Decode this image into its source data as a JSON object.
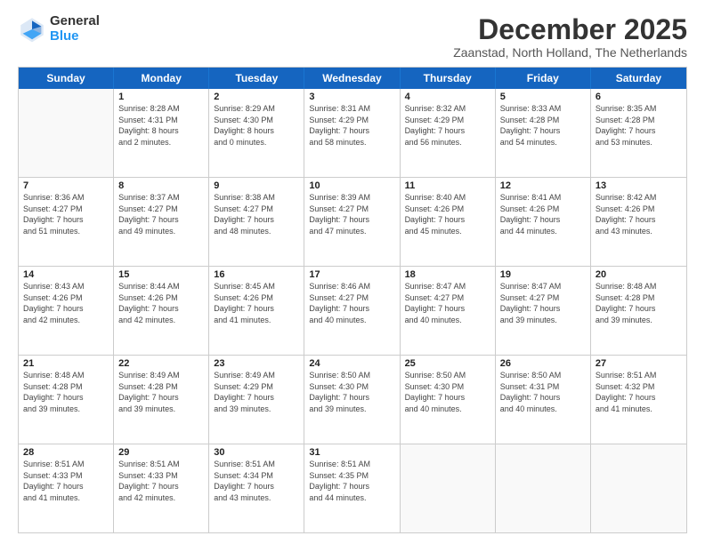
{
  "logo": {
    "general": "General",
    "blue": "Blue"
  },
  "title": "December 2025",
  "subtitle": "Zaanstad, North Holland, The Netherlands",
  "header_days": [
    "Sunday",
    "Monday",
    "Tuesday",
    "Wednesday",
    "Thursday",
    "Friday",
    "Saturday"
  ],
  "rows": [
    [
      {
        "day": "",
        "info": ""
      },
      {
        "day": "1",
        "info": "Sunrise: 8:28 AM\nSunset: 4:31 PM\nDaylight: 8 hours\nand 2 minutes."
      },
      {
        "day": "2",
        "info": "Sunrise: 8:29 AM\nSunset: 4:30 PM\nDaylight: 8 hours\nand 0 minutes."
      },
      {
        "day": "3",
        "info": "Sunrise: 8:31 AM\nSunset: 4:29 PM\nDaylight: 7 hours\nand 58 minutes."
      },
      {
        "day": "4",
        "info": "Sunrise: 8:32 AM\nSunset: 4:29 PM\nDaylight: 7 hours\nand 56 minutes."
      },
      {
        "day": "5",
        "info": "Sunrise: 8:33 AM\nSunset: 4:28 PM\nDaylight: 7 hours\nand 54 minutes."
      },
      {
        "day": "6",
        "info": "Sunrise: 8:35 AM\nSunset: 4:28 PM\nDaylight: 7 hours\nand 53 minutes."
      }
    ],
    [
      {
        "day": "7",
        "info": "Sunrise: 8:36 AM\nSunset: 4:27 PM\nDaylight: 7 hours\nand 51 minutes."
      },
      {
        "day": "8",
        "info": "Sunrise: 8:37 AM\nSunset: 4:27 PM\nDaylight: 7 hours\nand 49 minutes."
      },
      {
        "day": "9",
        "info": "Sunrise: 8:38 AM\nSunset: 4:27 PM\nDaylight: 7 hours\nand 48 minutes."
      },
      {
        "day": "10",
        "info": "Sunrise: 8:39 AM\nSunset: 4:27 PM\nDaylight: 7 hours\nand 47 minutes."
      },
      {
        "day": "11",
        "info": "Sunrise: 8:40 AM\nSunset: 4:26 PM\nDaylight: 7 hours\nand 45 minutes."
      },
      {
        "day": "12",
        "info": "Sunrise: 8:41 AM\nSunset: 4:26 PM\nDaylight: 7 hours\nand 44 minutes."
      },
      {
        "day": "13",
        "info": "Sunrise: 8:42 AM\nSunset: 4:26 PM\nDaylight: 7 hours\nand 43 minutes."
      }
    ],
    [
      {
        "day": "14",
        "info": "Sunrise: 8:43 AM\nSunset: 4:26 PM\nDaylight: 7 hours\nand 42 minutes."
      },
      {
        "day": "15",
        "info": "Sunrise: 8:44 AM\nSunset: 4:26 PM\nDaylight: 7 hours\nand 42 minutes."
      },
      {
        "day": "16",
        "info": "Sunrise: 8:45 AM\nSunset: 4:26 PM\nDaylight: 7 hours\nand 41 minutes."
      },
      {
        "day": "17",
        "info": "Sunrise: 8:46 AM\nSunset: 4:27 PM\nDaylight: 7 hours\nand 40 minutes."
      },
      {
        "day": "18",
        "info": "Sunrise: 8:47 AM\nSunset: 4:27 PM\nDaylight: 7 hours\nand 40 minutes."
      },
      {
        "day": "19",
        "info": "Sunrise: 8:47 AM\nSunset: 4:27 PM\nDaylight: 7 hours\nand 39 minutes."
      },
      {
        "day": "20",
        "info": "Sunrise: 8:48 AM\nSunset: 4:28 PM\nDaylight: 7 hours\nand 39 minutes."
      }
    ],
    [
      {
        "day": "21",
        "info": "Sunrise: 8:48 AM\nSunset: 4:28 PM\nDaylight: 7 hours\nand 39 minutes."
      },
      {
        "day": "22",
        "info": "Sunrise: 8:49 AM\nSunset: 4:28 PM\nDaylight: 7 hours\nand 39 minutes."
      },
      {
        "day": "23",
        "info": "Sunrise: 8:49 AM\nSunset: 4:29 PM\nDaylight: 7 hours\nand 39 minutes."
      },
      {
        "day": "24",
        "info": "Sunrise: 8:50 AM\nSunset: 4:30 PM\nDaylight: 7 hours\nand 39 minutes."
      },
      {
        "day": "25",
        "info": "Sunrise: 8:50 AM\nSunset: 4:30 PM\nDaylight: 7 hours\nand 40 minutes."
      },
      {
        "day": "26",
        "info": "Sunrise: 8:50 AM\nSunset: 4:31 PM\nDaylight: 7 hours\nand 40 minutes."
      },
      {
        "day": "27",
        "info": "Sunrise: 8:51 AM\nSunset: 4:32 PM\nDaylight: 7 hours\nand 41 minutes."
      }
    ],
    [
      {
        "day": "28",
        "info": "Sunrise: 8:51 AM\nSunset: 4:33 PM\nDaylight: 7 hours\nand 41 minutes."
      },
      {
        "day": "29",
        "info": "Sunrise: 8:51 AM\nSunset: 4:33 PM\nDaylight: 7 hours\nand 42 minutes."
      },
      {
        "day": "30",
        "info": "Sunrise: 8:51 AM\nSunset: 4:34 PM\nDaylight: 7 hours\nand 43 minutes."
      },
      {
        "day": "31",
        "info": "Sunrise: 8:51 AM\nSunset: 4:35 PM\nDaylight: 7 hours\nand 44 minutes."
      },
      {
        "day": "",
        "info": ""
      },
      {
        "day": "",
        "info": ""
      },
      {
        "day": "",
        "info": ""
      }
    ]
  ]
}
